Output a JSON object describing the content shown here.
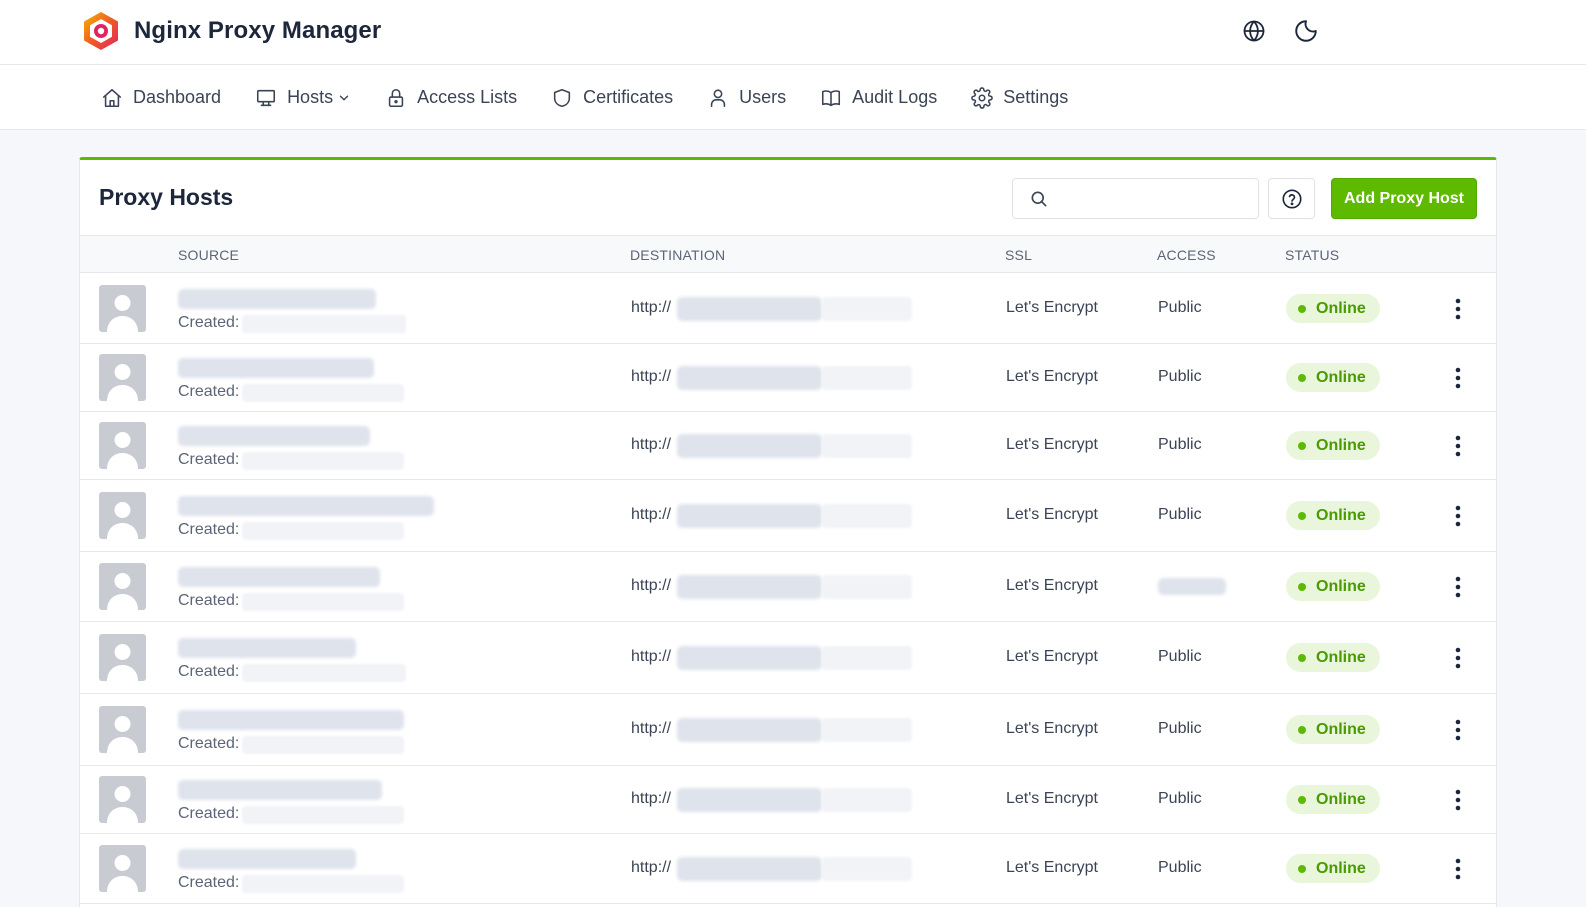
{
  "app": {
    "title": "Nginx Proxy Manager",
    "brand_color": "#5eba00",
    "top_icons": [
      "globe-icon",
      "moon-icon"
    ]
  },
  "nav": {
    "items": [
      {
        "label": "Dashboard",
        "icon": "home-icon"
      },
      {
        "label": "Hosts",
        "icon": "monitor-icon",
        "dropdown": true
      },
      {
        "label": "Access Lists",
        "icon": "lock-icon"
      },
      {
        "label": "Certificates",
        "icon": "shield-icon"
      },
      {
        "label": "Users",
        "icon": "user-icon"
      },
      {
        "label": "Audit Logs",
        "icon": "book-icon"
      },
      {
        "label": "Settings",
        "icon": "gear-icon"
      }
    ]
  },
  "card": {
    "title": "Proxy Hosts",
    "search_placeholder": "",
    "add_button": "Add Proxy Host"
  },
  "table": {
    "columns": {
      "source": "SOURCE",
      "destination": "DESTINATION",
      "ssl": "SSL",
      "access": "ACCESS",
      "status": "STATUS"
    },
    "rows": [
      {
        "created": "Created:",
        "dest_prefix": "http://",
        "ssl": "Let's Encrypt",
        "access": "Public",
        "status": "Online"
      },
      {
        "created": "Created:",
        "dest_prefix": "http://",
        "ssl": "Let's Encrypt",
        "access": "Public",
        "status": "Online"
      },
      {
        "created": "Created:",
        "dest_prefix": "http://",
        "ssl": "Let's Encrypt",
        "access": "Public",
        "status": "Online"
      },
      {
        "created": "Created:",
        "dest_prefix": "http://",
        "ssl": "Let's Encrypt",
        "access": "Public",
        "status": "Online"
      },
      {
        "created": "Created:",
        "dest_prefix": "http://",
        "ssl": "Let's Encrypt",
        "access": "",
        "status": "Online"
      },
      {
        "created": "Created:",
        "dest_prefix": "http://",
        "ssl": "Let's Encrypt",
        "access": "Public",
        "status": "Online"
      },
      {
        "created": "Created:",
        "dest_prefix": "http://",
        "ssl": "Let's Encrypt",
        "access": "Public",
        "status": "Online"
      },
      {
        "created": "Created:",
        "dest_prefix": "http://",
        "ssl": "Let's Encrypt",
        "access": "Public",
        "status": "Online"
      },
      {
        "created": "Created:",
        "dest_prefix": "http://",
        "ssl": "Let's Encrypt",
        "access": "Public",
        "status": "Online"
      }
    ]
  }
}
